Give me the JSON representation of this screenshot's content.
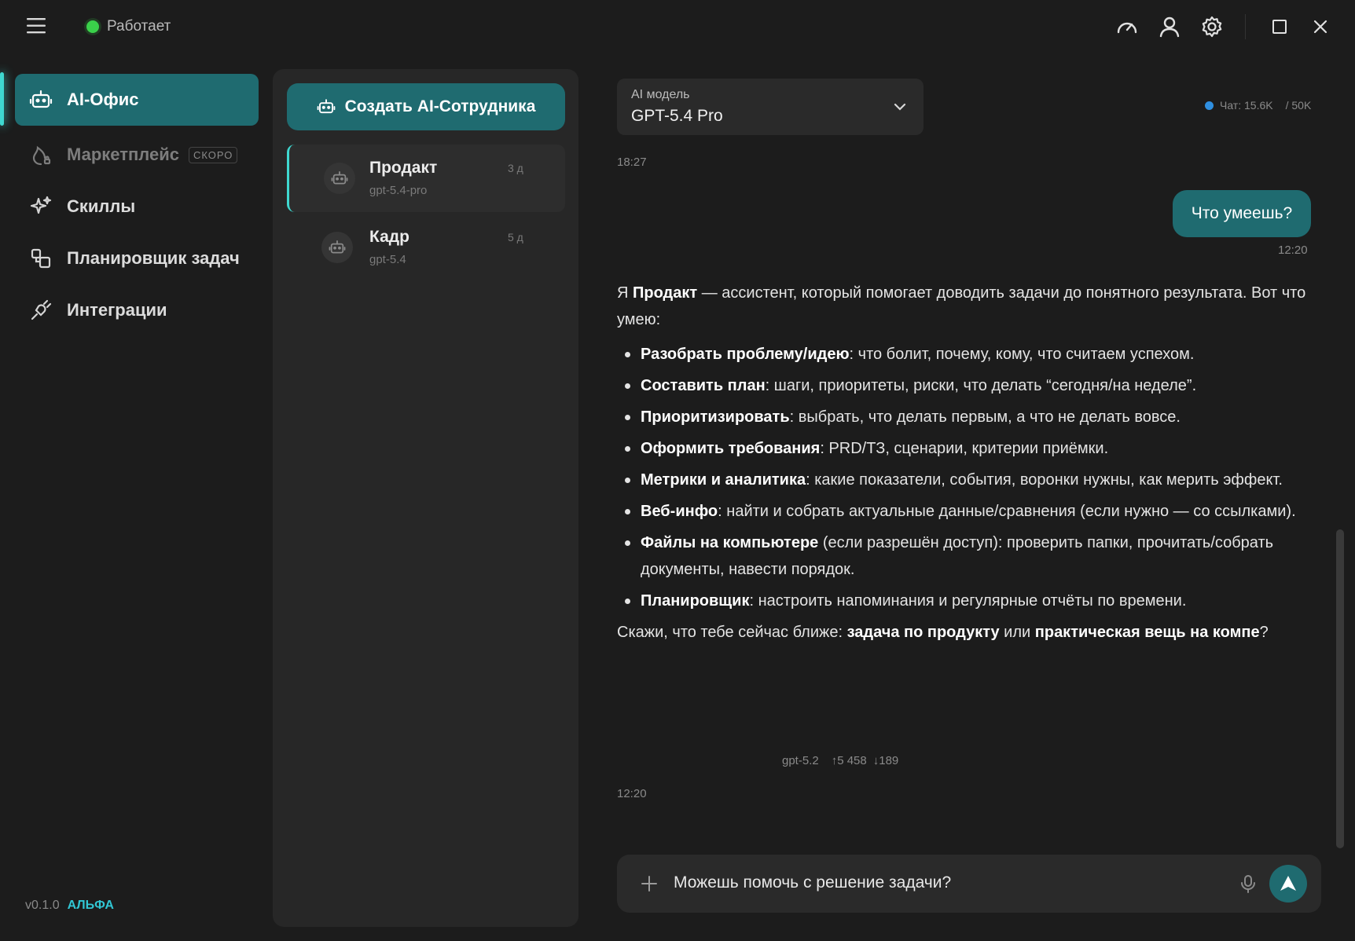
{
  "titlebar": {
    "status": "Работает",
    "icons": [
      "menu-icon",
      "speedometer-icon",
      "user-icon",
      "gear-icon",
      "maximize-icon",
      "close-icon"
    ]
  },
  "nav": {
    "items": [
      {
        "label": "AI-Офис",
        "icon": "robot-icon"
      },
      {
        "label": "Маркетплейс",
        "icon": "flame-icon",
        "badge": "СКОРО"
      },
      {
        "label": "Скиллы",
        "icon": "sparkle-icon"
      },
      {
        "label": "Планировщик задач",
        "icon": "scheduler-icon"
      },
      {
        "label": "Интеграции",
        "icon": "plug-icon"
      }
    ],
    "version": "v0.1.0",
    "channel": "АЛЬФА"
  },
  "agents": {
    "create_label": "Создать AI-Сотрудника",
    "list": [
      {
        "name": "Продакт",
        "model": "gpt-5.4-pro",
        "age": "3 д"
      },
      {
        "name": "Кадр",
        "model": "gpt-5.4",
        "age": "5 д"
      }
    ]
  },
  "chat": {
    "model_label": "AI модель",
    "model_value": "GPT-5.4 Pro",
    "usage_chat": "Чат: 15.6K",
    "usage_limit": "/ 50K",
    "time_top": "18:27",
    "user_message": "Что умеешь?",
    "user_time": "12:20",
    "reply": {
      "intro_pre": "Я ",
      "intro_bold": "Продакт",
      "intro_post": " — ассистент, который помогает доводить задачи до понятного результата. Вот что умею:",
      "bullets": [
        {
          "bold": "Разобрать проблему/идею",
          "text": ": что болит, почему, кому, что считаем успехом."
        },
        {
          "bold": "Составить план",
          "text": ": шаги, приоритеты, риски, что делать “сегодня/на неделе”."
        },
        {
          "bold": "Приоритизировать",
          "text": ": выбрать, что делать первым, а что не делать вовсе."
        },
        {
          "bold": "Оформить требования",
          "text": ": PRD/ТЗ, сценарии, критерии приёмки."
        },
        {
          "bold": "Метрики и аналитика",
          "text": ": какие показатели, события, воронки нужны, как мерить эффект."
        },
        {
          "bold": "Веб-инфо",
          "text": ": найти и собрать актуальные данные/сравнения (если нужно — со ссылками)."
        },
        {
          "bold": "Файлы на компьютере",
          "text": " (если разрешён доступ): проверить папки, прочитать/собрать документы, навести порядок."
        },
        {
          "bold": "Планировщик",
          "text": ": настроить напоминания и регулярные отчёты по времени."
        }
      ],
      "outro_pre": "Скажи, что тебе сейчас ближе: ",
      "outro_bold1": "задача по продукту",
      "outro_mid": " или ",
      "outro_bold2": "практическая вещь на компе",
      "outro_post": "?"
    },
    "reply_model": "gpt-5.2",
    "tokens_in": "↑5 458",
    "tokens_out": "↓189",
    "reply_time": "12:20"
  },
  "input": {
    "value": "Можешь помочь с решение задачи?"
  },
  "colors": {
    "accent": "#1f6b70",
    "accent_glow": "#3fd8d0",
    "status_ok": "#3ad14a",
    "alpha_tag": "#31c6d4"
  }
}
